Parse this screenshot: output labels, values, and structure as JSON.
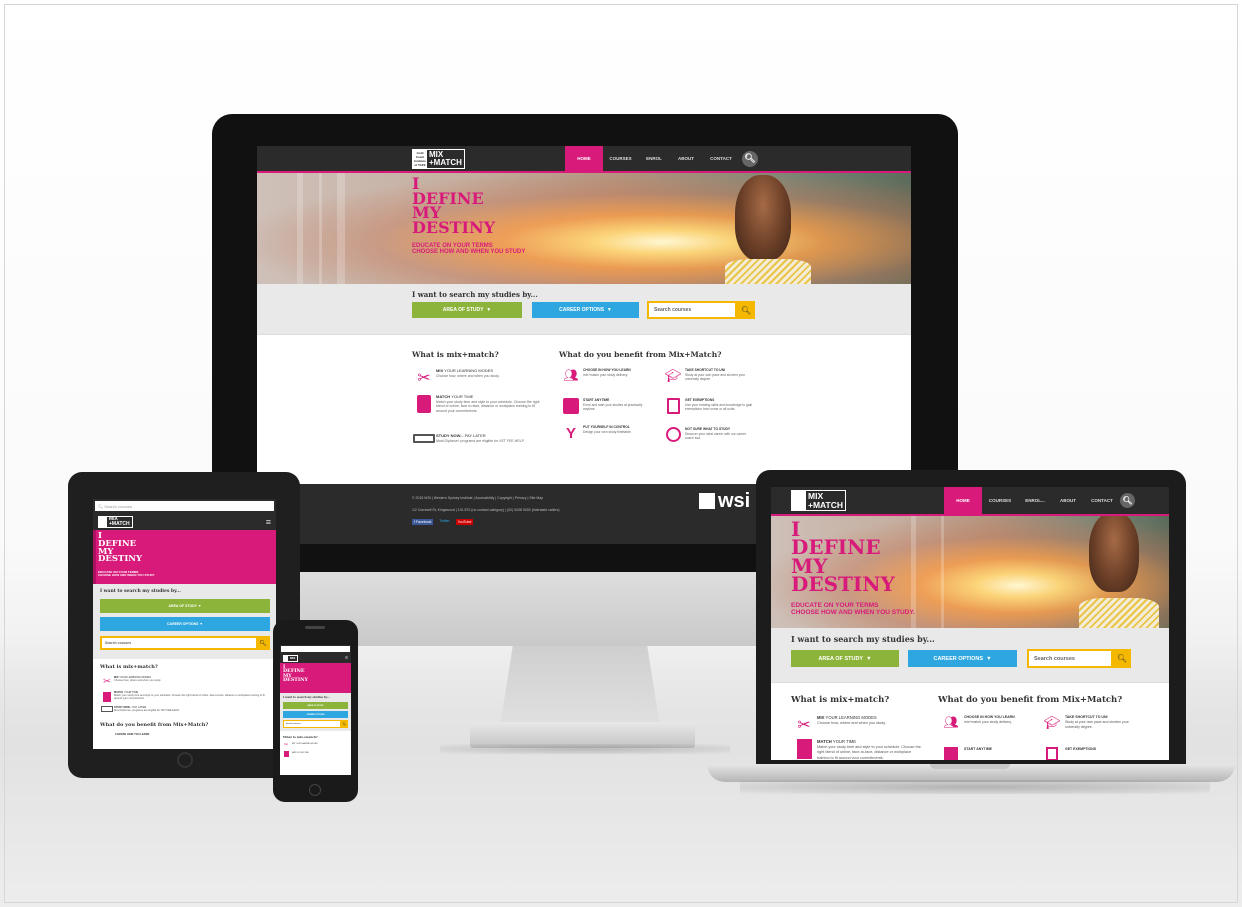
{
  "brand": {
    "logo_left": "Gold Coast Institute of TAFE",
    "logo_right_top": "MIX",
    "logo_right_bottom": "+MATCH",
    "footer_logo": "wsi"
  },
  "colors": {
    "pink": "#d81b7b",
    "green": "#8db43a",
    "blue": "#2ea7e0",
    "yellow": "#f5b800",
    "dark": "#2b2b2b"
  },
  "nav": {
    "items": [
      {
        "label": "HOME",
        "active": true
      },
      {
        "label": "COURSES"
      },
      {
        "label": "ENROL"
      },
      {
        "label": "ABOUT"
      },
      {
        "label": "CONTACT"
      }
    ],
    "laptop_enrol": "ENROL...",
    "search_icon": "search-icon"
  },
  "hero": {
    "line1": "I",
    "line2": "DEFINE",
    "line3": "MY",
    "line4": "DESTINY",
    "sub1": "EDUCATE ON YOUR TERMS",
    "sub2": "CHOOSE HOW AND WHEN YOU STUDY",
    "sub2_laptop": "CHOOSE HOW AND WHEN YOU STUDY."
  },
  "search": {
    "title": "I want to search my studies by...",
    "area_label": "AREA OF STUDY",
    "career_label": "CAREER OPTIONS",
    "placeholder": "Search courses",
    "arrow": "▼"
  },
  "what_is": {
    "title": "What is mix+match?",
    "items": [
      {
        "title_bold": "MIX",
        "title_rest": " YOUR LEARNING MODES",
        "desc": "Choose how, where and when you study."
      },
      {
        "title_bold": "MATCH",
        "title_rest": " YOUR TIME",
        "desc": "Match your study time and style to your schedule. Choose the right blend of online, face-to-face, distance or workplace training to fit around your commitments."
      },
      {
        "title_bold": "STUDY NOW...",
        "title_rest": " PAY LATER",
        "desc": "Most Diploma+ programs are eligible for VET FEE-HELP."
      }
    ]
  },
  "benefits": {
    "title": "What do you benefit from Mix+Match?",
    "items": [
      {
        "title": "CHOOSE IN HOW YOU LEARN",
        "desc": "mix+match your study delivery."
      },
      {
        "title": "START ANYTIME",
        "desc": "Enrol and start your studies at practically anytime."
      },
      {
        "title": "PUT YOURSELF IN CONTROL",
        "desc": "Design your own study timetable."
      },
      {
        "title": "TAKE SHORTCUT TO UNI",
        "desc": "Study at your own pace and shorten your university degree."
      },
      {
        "title": "GET EXEMPTIONS",
        "desc": "Use your existing skills and knowledge to gain exemptions from some or all units."
      },
      {
        "title": "NOT SURE WHAT TO STUDY",
        "desc": "Discover your ideal career with our career coach tool."
      }
    ]
  },
  "footer": {
    "line1": "© 2015 WSI | Western Sydney Institute | Accessibility | Copyright | Privacy | Site Map",
    "line2": "1/2 Cornwell St, Kingswood | 131 870 (no contact category) | (02) 9208 9000 (interstate callers)",
    "facebook": "f Facebook",
    "twitter": "Twitter",
    "youtube": "YouTube"
  },
  "tablet": {
    "search_placeholder": "Search courses",
    "menu_icon": "≡",
    "area_label": "AREA OF STUDY",
    "career_label": "CAREER OPTIONS",
    "benefits_title": "What do you benefit from Mix+Match?",
    "choose_item": "CHOOSE HOW YOU LEARN"
  }
}
